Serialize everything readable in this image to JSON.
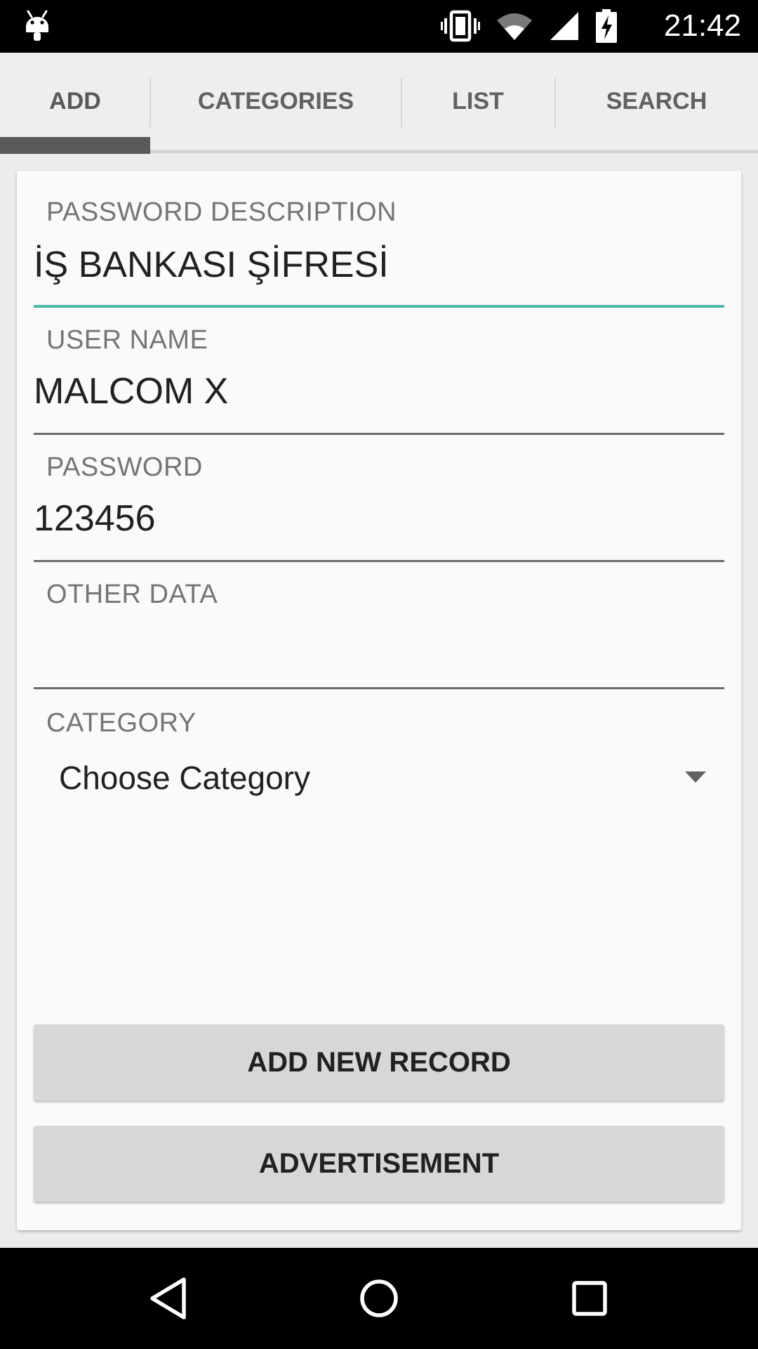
{
  "status_bar": {
    "time": "21:42",
    "icons": [
      "android-notification-icon",
      "vibrate-icon",
      "wifi-icon",
      "cell-signal-icon",
      "battery-charging-icon"
    ]
  },
  "tabs": [
    {
      "label": "ADD",
      "active": true
    },
    {
      "label": "CATEGORIES",
      "active": false
    },
    {
      "label": "LIST",
      "active": false
    },
    {
      "label": "SEARCH",
      "active": false
    }
  ],
  "form": {
    "description": {
      "label": "PASSWORD DESCRIPTION",
      "value": "İŞ BANKASI ŞİFRESİ"
    },
    "username": {
      "label": "USER NAME",
      "value": "MALCOM X"
    },
    "password": {
      "label": "PASSWORD",
      "value": "123456"
    },
    "other": {
      "label": "OTHER DATA",
      "value": ""
    },
    "category": {
      "label": "CATEGORY",
      "selected": "Choose Category"
    }
  },
  "buttons": {
    "add_record": "ADD NEW RECORD",
    "advertisement": "ADVERTISEMENT"
  },
  "nav_bar": {
    "icons": [
      "back-icon",
      "home-icon",
      "recents-icon"
    ]
  },
  "colors": {
    "focus_accent": "#4db6ac",
    "tab_indicator": "#5a5a5a",
    "button_bg": "#d6d7d7"
  }
}
